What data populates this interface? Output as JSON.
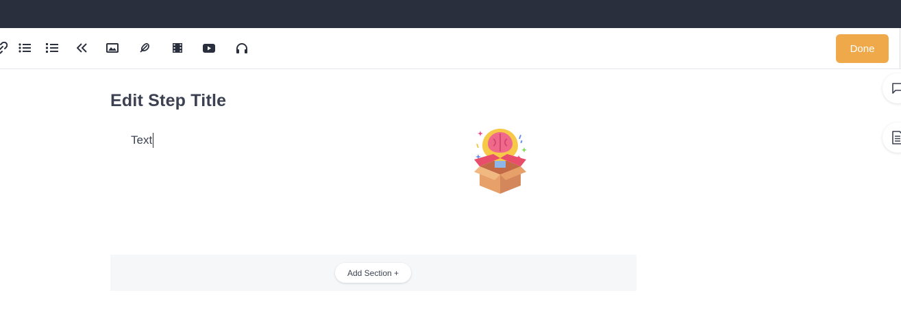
{
  "toolbar": {
    "done_label": "Done",
    "icons": [
      "link-icon",
      "bullet-list-icon",
      "numbered-list-icon",
      "collapse-icon",
      "image-icon",
      "feather-icon",
      "film-icon",
      "youtube-icon",
      "headphones-icon"
    ]
  },
  "sidebar": {
    "tabs": [
      "comment-icon",
      "document-icon"
    ]
  },
  "step": {
    "title": "Edit Step Title",
    "text": "Text"
  },
  "section": {
    "add_label": "Add Section +"
  },
  "colors": {
    "topbar": "#2a2f3d",
    "accent": "#f0a94a",
    "text": "#3b4150"
  }
}
